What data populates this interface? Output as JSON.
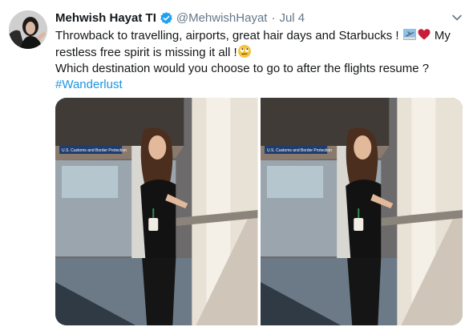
{
  "tweet": {
    "author_name": "Mehwish Hayat TI",
    "handle": "@MehwishHayat",
    "separator": "·",
    "date": "Jul 4",
    "line1": "Throwback to travelling, airports, great hair days and Starbucks !",
    "line1_tail": "My",
    "line2": "restless free spirit is missing it all !",
    "line3": "Which destination would you choose to go to after the flights resume ?",
    "hashtag": "#Wanderlust",
    "icons": {
      "verified": "verified-badge-icon",
      "menu": "chevron-down-icon",
      "emoji1": "airplane-departure-emoji-icon",
      "emoji2": "heart-emoji-icon",
      "emoji3": "rolling-eyes-emoji-icon"
    },
    "colors": {
      "link": "#1b95e0",
      "verified": "#1da1f2",
      "secondary_text": "#657786",
      "heart": "#c81e3a"
    },
    "media": {
      "photos": [
        {
          "sign_text": "U.S. Customs and Border Protection"
        },
        {
          "sign_text": "U.S. Customs and Border Protection"
        }
      ]
    }
  }
}
